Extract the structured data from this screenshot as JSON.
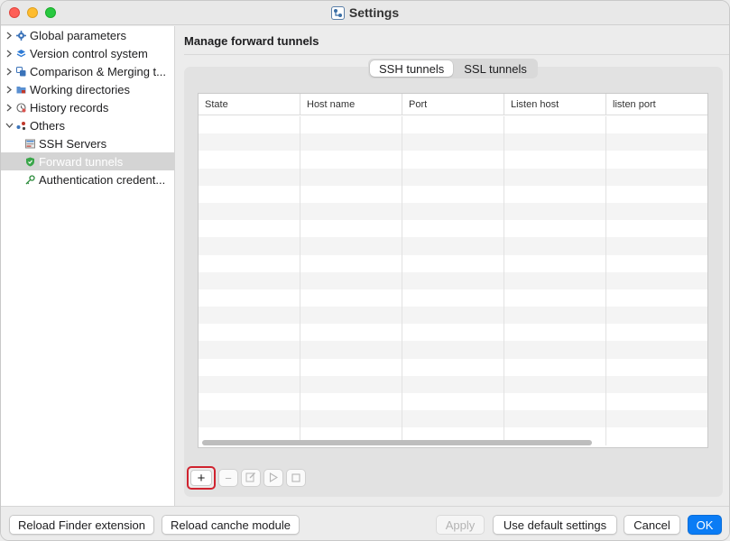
{
  "window": {
    "title": "Settings"
  },
  "sidebar": {
    "items": [
      {
        "label": "Global parameters",
        "expanded": false,
        "icon": "gear-icon"
      },
      {
        "label": "Version control system",
        "expanded": false,
        "icon": "layers-icon"
      },
      {
        "label": "Comparison & Merging t...",
        "expanded": false,
        "icon": "compare-icon"
      },
      {
        "label": "Working directories",
        "expanded": false,
        "icon": "folder-icon"
      },
      {
        "label": "History records",
        "expanded": false,
        "icon": "history-icon"
      },
      {
        "label": "Others",
        "expanded": true,
        "icon": "others-icon"
      }
    ],
    "children": [
      {
        "label": "SSH Servers",
        "icon": "server-icon",
        "selected": false
      },
      {
        "label": "Forward tunnels",
        "icon": "shield-icon",
        "selected": true
      },
      {
        "label": "Authentication credent...",
        "icon": "key-icon",
        "selected": false
      }
    ]
  },
  "main": {
    "section_title": "Manage forward tunnels",
    "tabs": [
      {
        "label": "SSH tunnels",
        "active": true
      },
      {
        "label": "SSL tunnels",
        "active": false
      }
    ],
    "table": {
      "columns": [
        "State",
        "Host name",
        "Port",
        "Listen host",
        "listen port"
      ],
      "rows": []
    },
    "toolbar": {
      "add": "+",
      "remove": "−",
      "edit": "edit-icon",
      "start": "play-icon",
      "stop": "stop-icon"
    }
  },
  "footer": {
    "reload_finder": "Reload Finder extension",
    "reload_module": "Reload canche module",
    "apply": "Apply",
    "use_default": "Use default settings",
    "cancel": "Cancel",
    "ok": "OK"
  },
  "colors": {
    "accent": "#0a7cf5",
    "highlight_box": "#d0232f",
    "selection": "#d4d4d4"
  }
}
